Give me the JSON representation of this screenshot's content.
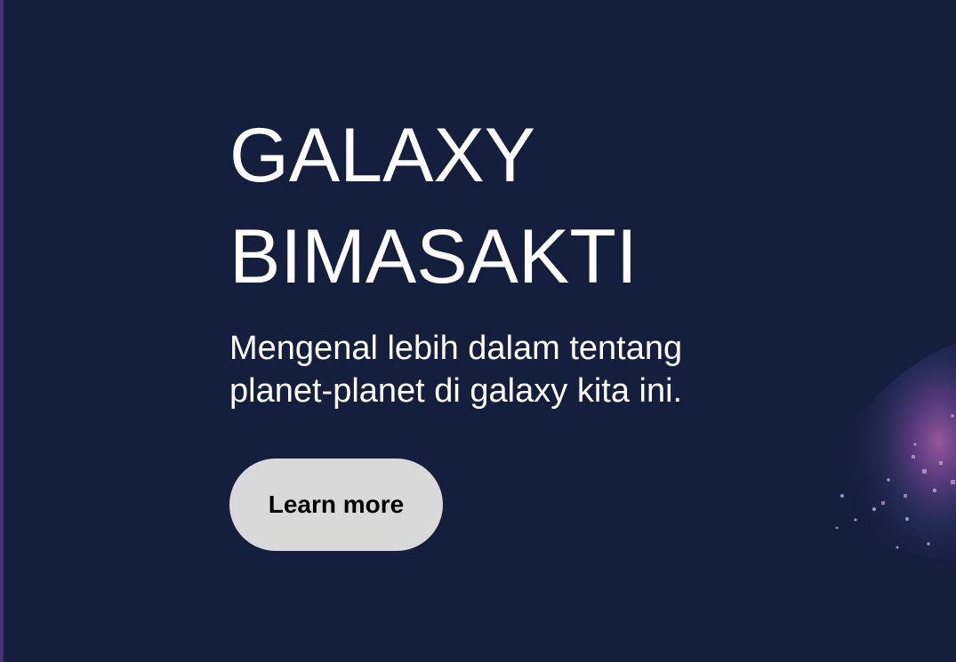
{
  "hero": {
    "title_line_1": "GALAXY",
    "title_line_2": "BIMASAKTI",
    "subtitle_line_1": "Mengenal lebih dalam tentang",
    "subtitle_line_2": "planet-planet di galaxy kita ini.",
    "button_label": "Learn more"
  },
  "colors": {
    "background": "#141e3d",
    "accent_edge": "#4a2f78",
    "button_background": "#d9d9d9",
    "text": "#ffffff"
  },
  "decorations": {
    "galaxy_image": "galaxy-nebula-image"
  }
}
